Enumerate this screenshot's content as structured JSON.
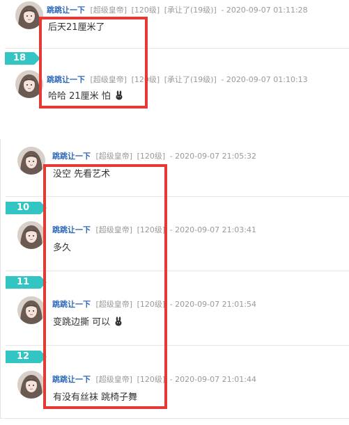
{
  "top_section": {
    "posts": [
      {
        "username": "跳跳让一下",
        "tags": [
          "[超级皇帝]",
          "[120级]",
          "[承让了(19级)]"
        ],
        "time": "- 2020-09-07 01:11:28",
        "content": "后天21厘米了",
        "emoji": false
      },
      {
        "floor": "18",
        "username": "跳跳让一下",
        "tags": [
          "[超级皇帝]",
          "[120级]",
          "[承让了(19级)]"
        ],
        "time": "- 2020-09-07 01:10:13",
        "content": "哈哈 21厘米 怕",
        "emoji": true
      }
    ]
  },
  "bottom_section": {
    "posts": [
      {
        "username": "跳跳让一下",
        "tags": [
          "[超级皇帝]",
          "[120级]"
        ],
        "time": "- 2020-09-07 21:05:32",
        "content": "没空 先看艺术",
        "emoji": false
      },
      {
        "floor": "10",
        "username": "跳跳让一下",
        "tags": [
          "[超级皇帝]",
          "[120级]"
        ],
        "time": "- 2020-09-07 21:03:41",
        "content": "多久",
        "emoji": false
      },
      {
        "floor": "11",
        "username": "跳跳让一下",
        "tags": [
          "[超级皇帝]",
          "[120级]"
        ],
        "time": "- 2020-09-07 21:01:54",
        "content": "变跳边撕 可以",
        "emoji": true
      },
      {
        "floor": "12",
        "username": "跳跳让一下",
        "tags": [
          "[超级皇帝]",
          "[120级]"
        ],
        "time": "- 2020-09-07 21:01:44",
        "content": "有没有丝袜 跳椅子舞",
        "emoji": false
      }
    ]
  },
  "colors": {
    "floor_badge": "#33c4c4",
    "username": "#2e68b8",
    "highlight_box": "#e53935"
  }
}
